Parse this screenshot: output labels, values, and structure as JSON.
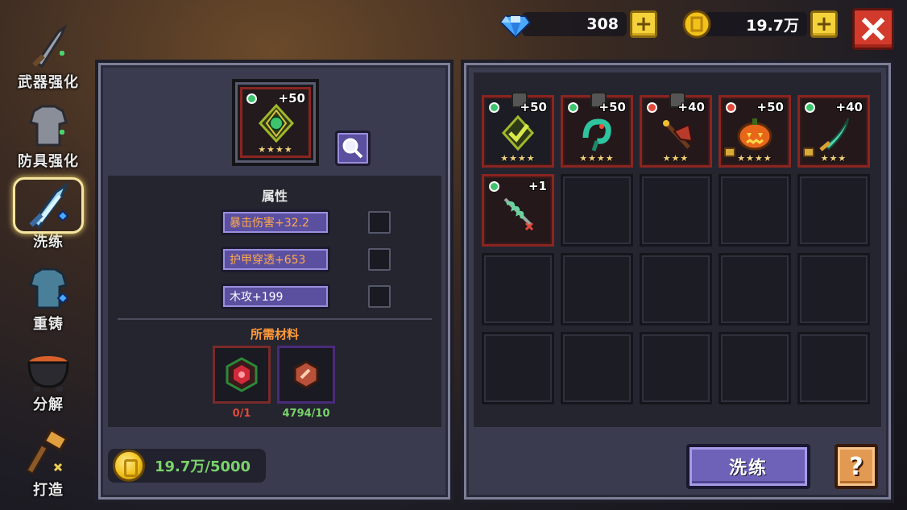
{
  "resources": {
    "gems": "308",
    "gold": "19.7万"
  },
  "tabs": [
    {
      "label": "武器强化",
      "icon": "sword-icon"
    },
    {
      "label": "防具强化",
      "icon": "armor-icon"
    },
    {
      "label": "洗练",
      "icon": "crystal-sword-icon"
    },
    {
      "label": "重铸",
      "icon": "chest-armor-icon"
    },
    {
      "label": "分解",
      "icon": "cauldron-icon"
    },
    {
      "label": "打造",
      "icon": "hammer-icon"
    }
  ],
  "left_panel": {
    "selected_item": {
      "level": "+50",
      "stars": "★★★★",
      "gem_color": "#3ec46d"
    },
    "attributes_title": "属性",
    "attributes": [
      {
        "text": "暴击伤害+32.2"
      },
      {
        "text": "护甲穿透+653"
      },
      {
        "text": "木攻+199"
      }
    ],
    "materials_title": "所需材料",
    "materials": [
      {
        "count": "0/1",
        "color": "#e04a3a"
      },
      {
        "count": "4794/10",
        "color": "#7ad46a"
      }
    ],
    "gold_cost": "19.7万/5000"
  },
  "inventory": [
    {
      "level": "+50",
      "stars": "★★★★",
      "gem": "#3ec46d",
      "locked_top": true,
      "locked_side": false,
      "icon": "green-amulet"
    },
    {
      "level": "+50",
      "stars": "★★★★",
      "gem": "#3ec46d",
      "locked_top": true,
      "locked_side": false,
      "icon": "snake-staff"
    },
    {
      "level": "+40",
      "stars": "★★★",
      "gem": "#e04a3a",
      "locked_top": true,
      "locked_side": false,
      "icon": "red-axe"
    },
    {
      "level": "+50",
      "stars": "★★★★",
      "gem": "#e04a3a",
      "locked_top": false,
      "locked_side": true,
      "icon": "pumpkin"
    },
    {
      "level": "+40",
      "stars": "★★★",
      "gem": "#3ec46d",
      "locked_top": false,
      "locked_side": true,
      "icon": "jade-blade"
    },
    {
      "level": "+1",
      "stars": "",
      "gem": "#3ec46d",
      "locked_top": false,
      "locked_side": false,
      "icon": "vine-staff"
    }
  ],
  "buttons": {
    "refine": "洗练",
    "help": "?"
  }
}
